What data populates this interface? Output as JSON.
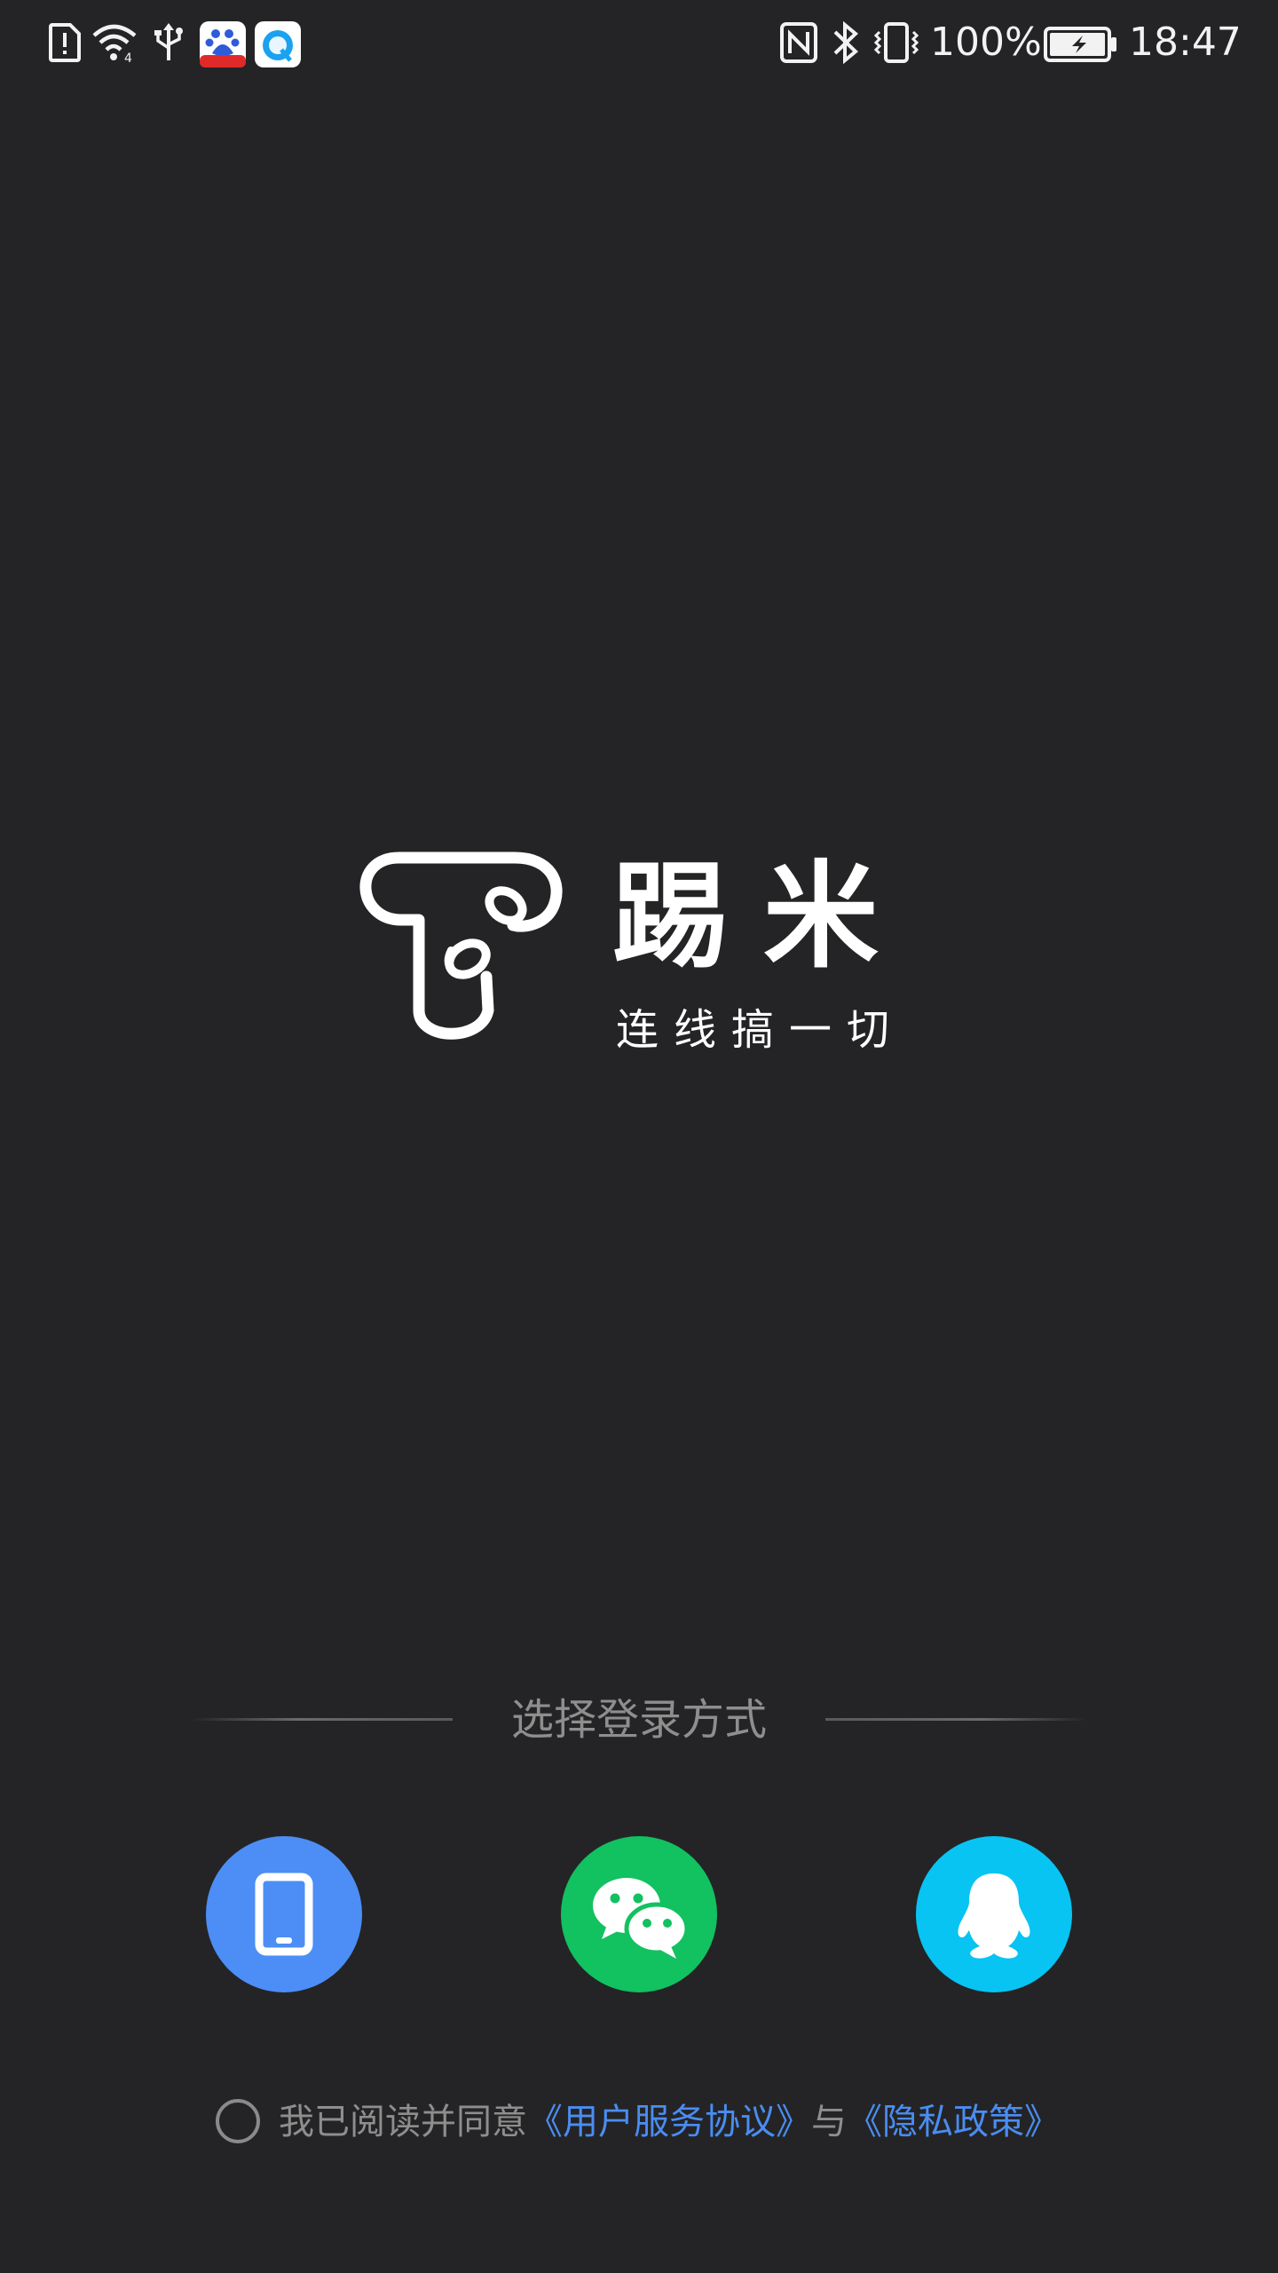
{
  "status_bar": {
    "icons_left": [
      "sim-alert-icon",
      "wifi-icon",
      "usb-icon",
      "baidu-app-icon",
      "browser-app-icon"
    ],
    "icons_right": [
      "nfc-icon",
      "bluetooth-icon",
      "vibrate-icon",
      "battery-icon"
    ],
    "battery_percent": "100%",
    "battery_level": 1.0,
    "time": "18:47"
  },
  "brand": {
    "name": "踢米",
    "slogan": "连线搞一切",
    "logo_icon": "earphone-t-logo"
  },
  "login": {
    "title": "选择登录方式",
    "options": [
      {
        "icon": "phone-icon",
        "color": "#4c8ef6"
      },
      {
        "icon": "wechat-icon",
        "color": "#12c160"
      },
      {
        "icon": "qq-icon",
        "color": "#08c4f2"
      }
    ]
  },
  "agreement": {
    "prefix": "我已阅读并同意",
    "user_agreement": "《用户服务协议》",
    "connector": "与",
    "privacy_policy": "《隐私政策》",
    "checked": false
  },
  "colors": {
    "background": "#242426",
    "link": "#4a8df2",
    "muted_text": "#8e8e8e"
  }
}
